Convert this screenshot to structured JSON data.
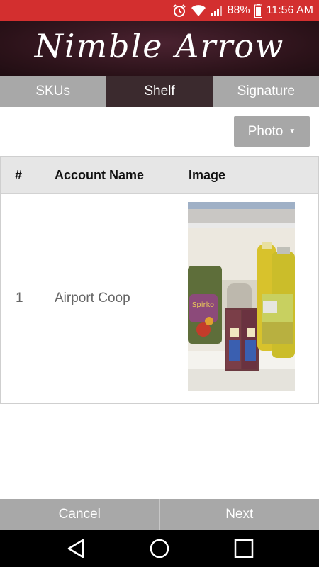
{
  "status_bar": {
    "battery": "88%",
    "time": "11:56 AM",
    "icons": [
      "alarm-icon",
      "wifi-icon",
      "signal-icon",
      "battery-icon"
    ]
  },
  "brand": {
    "title": "Nimble Arrow"
  },
  "tabs": [
    {
      "label": "SKUs",
      "active": false
    },
    {
      "label": "Shelf",
      "active": true
    },
    {
      "label": "Signature",
      "active": false
    }
  ],
  "photo_dropdown": {
    "label": "Photo"
  },
  "table": {
    "headers": {
      "num": "#",
      "account_name": "Account Name",
      "image": "Image"
    },
    "rows": [
      {
        "num": "1",
        "account_name": "Airport Coop"
      }
    ]
  },
  "actions": {
    "cancel": "Cancel",
    "next": "Next"
  },
  "colors": {
    "status_bar": "#d32f2f",
    "brand_bg": "#2b1219",
    "tab_active": "#3b2a2e",
    "tab_inactive": "#a8a8a8"
  }
}
